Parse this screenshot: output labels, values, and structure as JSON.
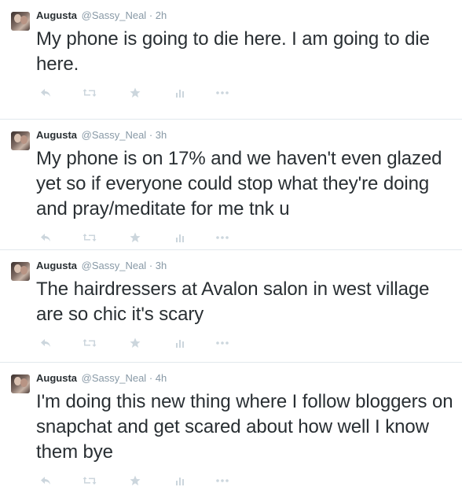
{
  "colors": {
    "name": "#292f33",
    "meta": "#8899a6",
    "text": "#292f33",
    "action_icon": "#ccd6dd",
    "divider": "#e1e8ed"
  },
  "tweets": [
    {
      "name": "Augusta",
      "handle": "@Sassy_Neal",
      "separator": "·",
      "time": "2h",
      "text": "My phone is going to die here. I am going to die here."
    },
    {
      "name": "Augusta",
      "handle": "@Sassy_Neal",
      "separator": "·",
      "time": "3h",
      "text": "My phone is on 17% and we haven't even glazed yet so if everyone could stop what they're doing and pray/meditate for me tnk u"
    },
    {
      "name": "Augusta",
      "handle": "@Sassy_Neal",
      "separator": "·",
      "time": "3h",
      "text": "The hairdressers at Avalon salon in west village are so chic it's scary"
    },
    {
      "name": "Augusta",
      "handle": "@Sassy_Neal",
      "separator": "·",
      "time": "4h",
      "text": "I'm doing this new thing where I follow bloggers on snapchat and get scared about how well I know them bye"
    }
  ],
  "action_icons": [
    "reply-icon",
    "retweet-icon",
    "favorite-icon",
    "stats-icon",
    "more-icon"
  ]
}
